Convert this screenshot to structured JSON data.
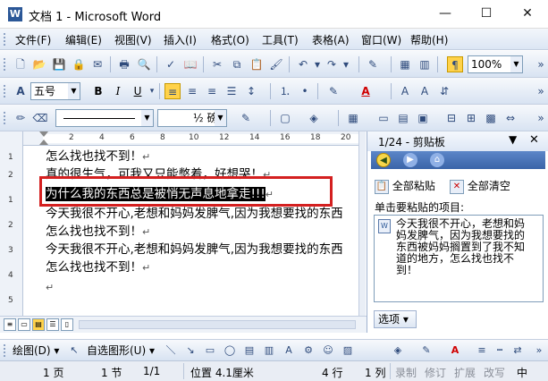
{
  "window": {
    "title": "文档 1 - Microsoft Word",
    "minimize": "—",
    "maximize": "☐",
    "close": "✕"
  },
  "menu": [
    "文件(F)",
    "编辑(E)",
    "视图(V)",
    "插入(I)",
    "格式(O)",
    "工具(T)",
    "表格(A)",
    "窗口(W)",
    "帮助(H)"
  ],
  "toolbar_standard": {
    "zoom": "100%"
  },
  "toolbar_format": {
    "style": "五号"
  },
  "toolbar_draw_lines": {
    "weight": "½ 磅"
  },
  "document": {
    "lines": [
      "怎么找也找不到！",
      "真的很生气，可我又只能憋着，好想哭！",
      "为什么我的东西总是被悄无声息地拿走!!!",
      "今天我很不开心,老想和妈妈发脾气,因为我想要找的东西",
      "怎么找也找不到！",
      "今天我很不开心,老想和妈妈发脾气,因为我想要找的东西",
      "怎么找也找不到！"
    ],
    "paragraph_mark": "↵"
  },
  "ruler": {
    "h_marks": [
      "2",
      "4",
      "6",
      "8",
      "10",
      "12",
      "14",
      "16",
      "18",
      "20"
    ],
    "v_marks": [
      "1",
      "2",
      "1",
      "2",
      "3",
      "4",
      "5"
    ]
  },
  "clipboard_pane": {
    "header": "1/24 - 剪贴板",
    "paste_all": "全部粘贴",
    "clear_all": "全部清空",
    "label": "单击要粘贴的项目:",
    "item_text": "今天我很不开心，老想和妈妈发脾气，因为我想要找的东西被妈妈搁置到了我不知道的地方，怎么找也找不到！",
    "options": "选项 ▾"
  },
  "draw_bar": {
    "draw": "绘图(D) ▾",
    "autoshapes": "自选图形(U) ▾"
  },
  "status": {
    "page": "1 页",
    "section": "1 节",
    "pages": "1/1",
    "position": "位置 4.1厘米",
    "line": "4 行",
    "column": "1 列",
    "rec": "录制",
    "trk": "修订",
    "ext": "扩展",
    "ovr": "改写",
    "lang": "中"
  }
}
